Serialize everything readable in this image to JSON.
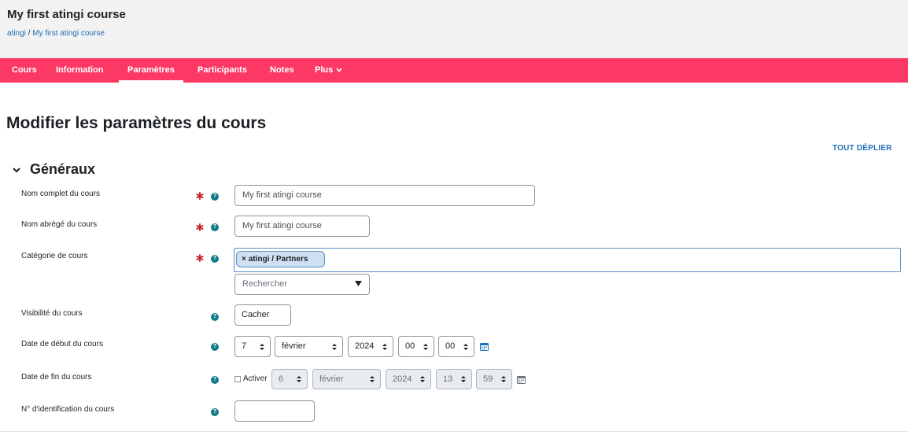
{
  "header": {
    "title": "My first atingi course",
    "breadcrumb": {
      "root": "atingi",
      "separator": "/",
      "current": "My first atingi course"
    }
  },
  "nav": {
    "items": [
      {
        "label": "Cours"
      },
      {
        "label": "Information"
      },
      {
        "label": "Paramètres",
        "active": true
      },
      {
        "label": "Participants"
      },
      {
        "label": "Notes"
      },
      {
        "label": "Plus"
      }
    ],
    "color": "#fb3964"
  },
  "page": {
    "title": "Modifier les paramètres du cours",
    "expand_all": "TOUT DÉPLIER"
  },
  "section": {
    "title": "Généraux"
  },
  "fields": {
    "fullname": {
      "label": "Nom complet du cours",
      "value": "My first atingi course"
    },
    "shortname": {
      "label": "Nom abrégé du cours",
      "value": "My first atingi course"
    },
    "category": {
      "label": "Catégorie de cours",
      "selected_tag": "atingi / Partners",
      "search_placeholder": "Rechercher"
    },
    "visibility": {
      "label": "Visibilité du cours",
      "value": "Cacher"
    },
    "startdate": {
      "label": "Date de début du cours",
      "day": "7",
      "month": "février",
      "year": "2024",
      "hour": "00",
      "minute": "00"
    },
    "enddate": {
      "label": "Date de fin du cours",
      "enable_label": "Activer",
      "enabled": false,
      "day": "6",
      "month": "février",
      "year": "2024",
      "hour": "13",
      "minute": "59"
    },
    "idnumber": {
      "label": "N° d'identification du cours",
      "value": ""
    }
  },
  "colors": {
    "accent": "#fb3964",
    "link": "#1f6fb5",
    "required": "#c9262c",
    "help": "#117a8b"
  }
}
